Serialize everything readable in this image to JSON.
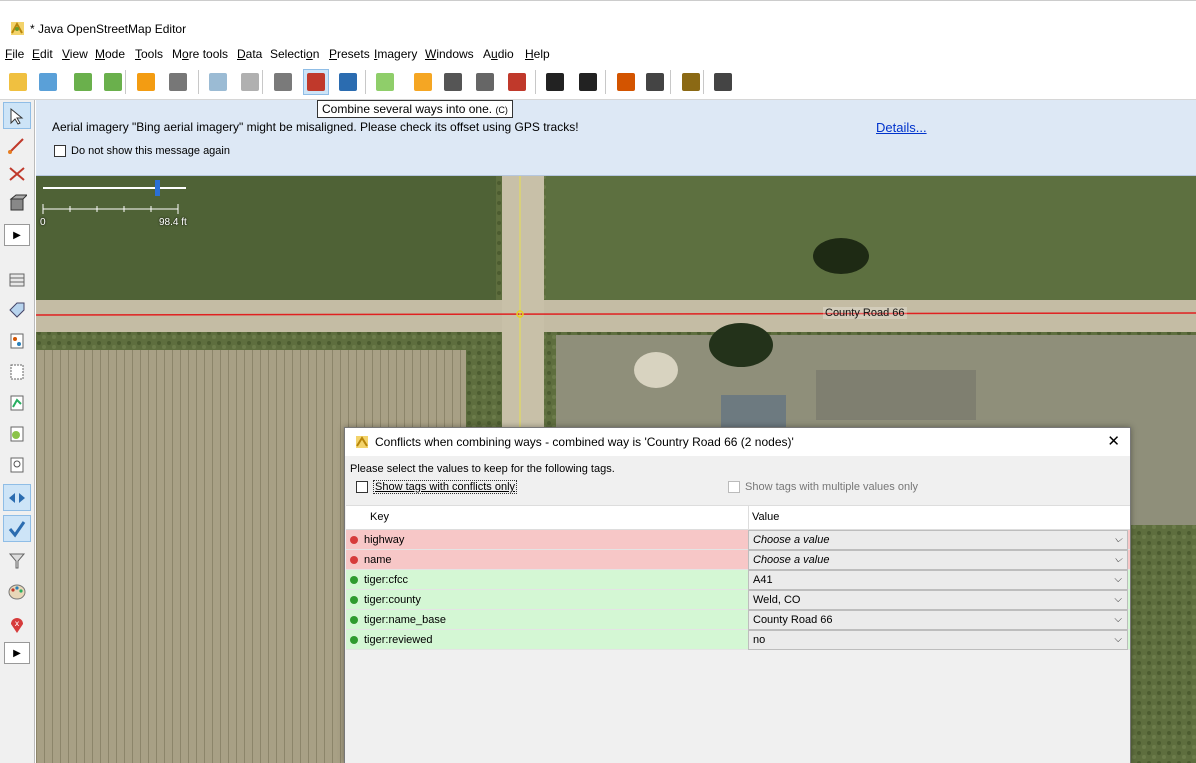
{
  "window": {
    "title": "* Java OpenStreetMap Editor"
  },
  "menu": {
    "items": [
      {
        "u": "F",
        "rest": "ile"
      },
      {
        "u": "E",
        "rest": "dit"
      },
      {
        "u": "V",
        "rest": "iew"
      },
      {
        "u": "M",
        "rest": "ode"
      },
      {
        "u": "T",
        "rest": "ools"
      },
      {
        "pre": "M",
        "u": "o",
        "rest": "re tools"
      },
      {
        "u": "D",
        "rest": "ata"
      },
      {
        "pre": "Selecti",
        "u": "o",
        "rest": "n"
      },
      {
        "u": "P",
        "rest": "resets"
      },
      {
        "u": "I",
        "rest": "magery"
      },
      {
        "u": "W",
        "rest": "indows"
      },
      {
        "pre": "A",
        "u": "u",
        "rest": "dio"
      },
      {
        "u": "H",
        "rest": "elp"
      }
    ]
  },
  "toolbar": {
    "tooltip_text": "Combine several ways into one.",
    "tooltip_shortcut": "(C)",
    "icons": [
      "open-icon",
      "download-icon",
      "download-object-icon",
      "upload-icon",
      "undo-icon",
      "redo-icon",
      "zoom-icon",
      "preferences-icon",
      "split-way-icon",
      "combine-way-icon",
      "reverse-way-icon",
      "preset-grid-icon",
      "road-preset-icon",
      "rail-preset-icon",
      "traffic-signal-icon",
      "wall-preset-icon",
      "car-icon",
      "bus-icon",
      "warning-icon",
      "food-icon",
      "castle-icon",
      "chart-icon"
    ]
  },
  "notice": {
    "message": "Aerial imagery \"Bing aerial imagery\" might be misaligned. Please check its offset using GPS tracks!",
    "details_link": "Details...",
    "dont_show": "Do not show this message again"
  },
  "map": {
    "road_label": "County Road 66",
    "scale_zero": "0",
    "scale_value": "98.4 ft"
  },
  "dialog": {
    "title": "Conflicts when combining ways - combined way is 'Country Road 66 (2 nodes)'",
    "instruction": "Please select the values to keep for the following tags.",
    "conflicts_only": "Show tags with conflicts only",
    "multiple_values_only": "Show tags with multiple values only",
    "col_key": "Key",
    "col_value": "Value",
    "rows": [
      {
        "key": "highway",
        "value": "Choose a value",
        "status": "conflict"
      },
      {
        "key": "name",
        "value": "Choose a value",
        "status": "conflict"
      },
      {
        "key": "tiger:cfcc",
        "value": "A41",
        "status": "ok"
      },
      {
        "key": "tiger:county",
        "value": "Weld, CO",
        "status": "ok"
      },
      {
        "key": "tiger:name_base",
        "value": "County Road 66",
        "status": "ok"
      },
      {
        "key": "tiger:reviewed",
        "value": "no",
        "status": "ok"
      }
    ],
    "colors": {
      "conflict_bg": "#f7c7c7",
      "ok_bg": "#d4f7d4",
      "conflict_dot": "#d63b3b",
      "ok_dot": "#2f9b2f"
    }
  }
}
